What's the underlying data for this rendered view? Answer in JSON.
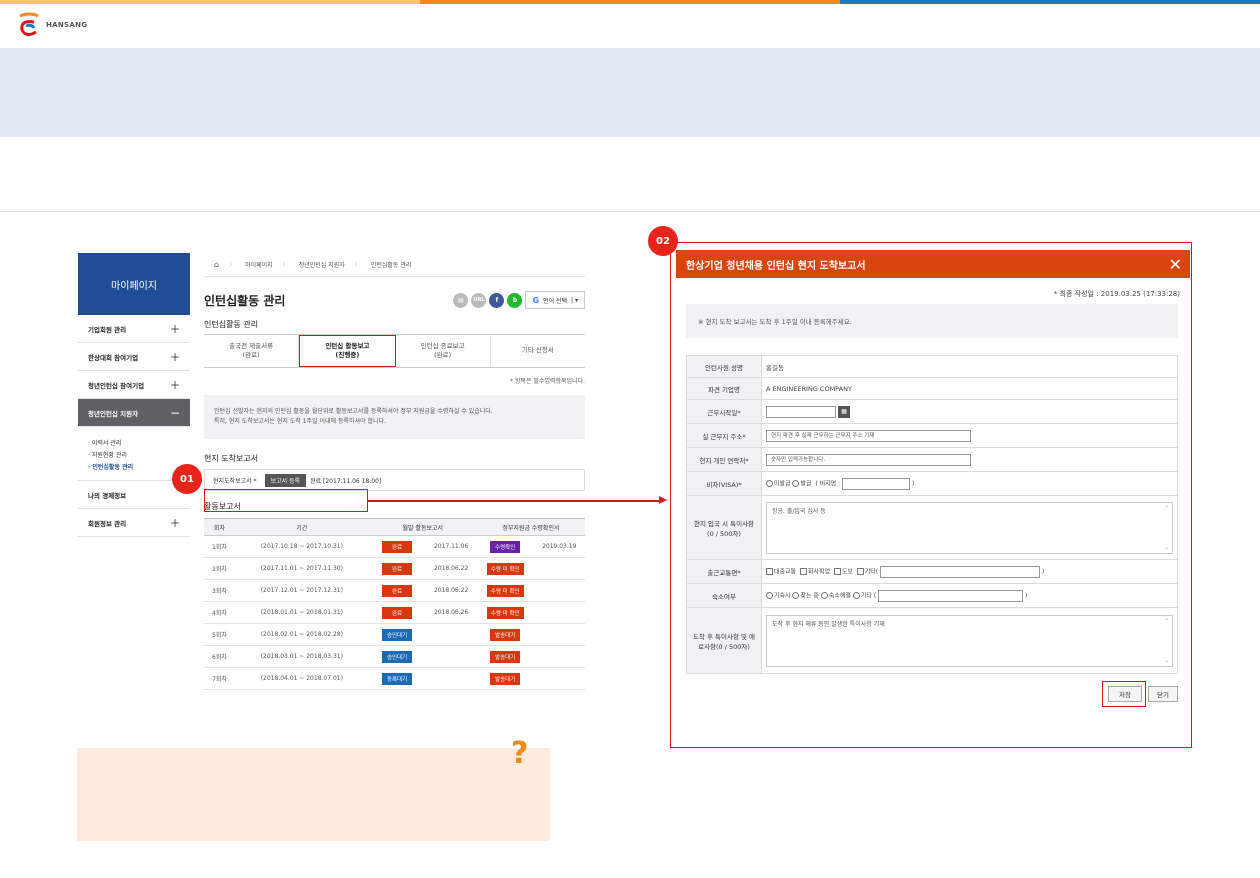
{
  "colors": {
    "top_bar": [
      "#f6c86a",
      "#f08a1c",
      "#1c7cc4"
    ],
    "brand_blue": "#1f4e96",
    "accent_red": "#d9141c",
    "modal_header": "#d9450e",
    "banner": "#e3e9f3",
    "help_box": "#fdebdf"
  },
  "logo": {
    "text": "HANSANG"
  },
  "sidebar": {
    "title": "마이페이지",
    "items": [
      {
        "label": "기업회원 관리",
        "toggle": "+"
      },
      {
        "label": "한상대회 참여기업",
        "toggle": "+"
      },
      {
        "label": "청년인턴십 참여기업",
        "toggle": "+"
      },
      {
        "label": "청년인턴십 지원자",
        "toggle": "−"
      },
      {
        "label": "나의 경제정보",
        "toggle": ""
      },
      {
        "label": "회원정보 관리",
        "toggle": "+"
      }
    ],
    "sub_items": [
      "이력서 관리",
      "지원현황 관리",
      "인턴십활동 관리"
    ]
  },
  "breadcrumb": [
    "마이페이지",
    "청년인턴십 지원자",
    "인턴십활동 관리"
  ],
  "page": {
    "title": "인턴십활동 관리",
    "section_title": "인턴십활동 관리",
    "lang_select": "언어 선택",
    "share_labels": [
      "URL",
      "f",
      "b"
    ],
    "tabs": [
      {
        "line1": "출국전 제출서류",
        "line2": "(완료)"
      },
      {
        "line1": "인턴십 활동보고",
        "line2": "(진행중)"
      },
      {
        "line1": "인턴십 종료보고",
        "line2": "(완료)"
      },
      {
        "line1": "기타 신청서",
        "line2": ""
      }
    ],
    "required_note": "* 항목은 필수입력항목입니다.",
    "notice_line1": "인턴십 선발자는 현지의 인턴십 활동을 월단위로 활동보고서를 등록하셔야 정부 지원금을 수령하실 수 있습니다.",
    "notice_line2": "특히, 현지 도착보고서는 현지 도착 1주일 이내에 등록하셔야 합니다.",
    "arrival_title": "현지 도착보고서",
    "arrival_label": "현지도착보고서 *",
    "arrival_button": "보고서 등록",
    "arrival_status": "완료 [2017.11.06 18:00]",
    "activity_title": "활동보고서",
    "table_headers": [
      "회차",
      "기간",
      "월말 활동보고서",
      "정부지원금 수령확인서"
    ],
    "rows": [
      {
        "no": "1회차",
        "period": "(2017.10.18 ~ 2017.10.31)",
        "report": "완료",
        "report_color": "red",
        "report_date": "2017.11.06",
        "gov": "수령확인",
        "gov_color": "purple",
        "gov_date": "2019.03.19"
      },
      {
        "no": "2회차",
        "period": "(2017.11.01 ~ 2017.11.30)",
        "report": "완료",
        "report_color": "red",
        "report_date": "2018.06.22",
        "gov": "수령 미 확인",
        "gov_color": "red",
        "gov_date": ""
      },
      {
        "no": "3회차",
        "period": "(2017.12.01 ~ 2017.12.31)",
        "report": "완료",
        "report_color": "red",
        "report_date": "2018.06.22",
        "gov": "수령 미 확인",
        "gov_color": "red",
        "gov_date": ""
      },
      {
        "no": "4회차",
        "period": "(2018.01.01 ~ 2018.01.31)",
        "report": "완료",
        "report_color": "red",
        "report_date": "2018.06.26",
        "gov": "수령 미 확인",
        "gov_color": "red",
        "gov_date": ""
      },
      {
        "no": "5회차",
        "period": "(2018.02.01 ~ 2018.02.28)",
        "report": "승인대기",
        "report_color": "blue",
        "report_date": "",
        "gov": "발송대기",
        "gov_color": "red",
        "gov_date": ""
      },
      {
        "no": "6회차",
        "period": "(2018.03.01 ~ 2018.03.31)",
        "report": "승인대기",
        "report_color": "blue",
        "report_date": "",
        "gov": "발송대기",
        "gov_color": "red",
        "gov_date": ""
      },
      {
        "no": "7회차",
        "period": "(2018.04.01 ~ 2018.07.01)",
        "report": "등록대기",
        "report_color": "blue",
        "report_date": "",
        "gov": "발송대기",
        "gov_color": "red",
        "gov_date": ""
      }
    ]
  },
  "callouts": [
    "01",
    "02"
  ],
  "help_mark": "?",
  "modal": {
    "title": "한상기업 청년채용 인턴십 현지 도착보고서",
    "close": "✕",
    "last_saved": "* 최종 작성일 : 2019.03.25 (17:33:28)",
    "notice": "※ 현지 도착 보고서는 도착 후 1주일 이내 등록해주세요.",
    "fields": {
      "name_label": "인턴사원 성명",
      "name_value": "홍길동",
      "company_label": "파견 기업명",
      "company_value": "A ENGINEERING COMPANY",
      "start_label": "근무시작일*",
      "address_label": "실 근무지 주소*",
      "address_placeholder": "현지 파견 후 실제 근무하는 근무지 주소 기재",
      "contact_label": "현지 개인 연락처*",
      "contact_placeholder": "숫자만 입력가능합니다.",
      "visa_label": "비자(VISA)*",
      "visa_options": [
        "미발급",
        "발급"
      ],
      "visa_name_label": "( 비자명 :",
      "visa_close": ")",
      "entry_label": "현지 입국 시 특이사항 (0 / 500자)",
      "entry_placeholder": "항공, 출/입국 심사 등",
      "commute_label": "출근교통편*",
      "commute_options": [
        "대중교통",
        "회사픽업",
        "도보",
        "기타("
      ],
      "commute_close": ")",
      "lodging_label": "숙소여부",
      "lodging_options": [
        "기숙사",
        "찾는 중",
        "숙소해결",
        "기타"
      ],
      "lodging_open": "(",
      "lodging_close": ")",
      "issue_label": "도착 후 특이사항 및 애로사항(0 / 500자)",
      "issue_placeholder": "도착 후 현지 체류 동안 발생한 특이사항 기재"
    },
    "save_button": "저장",
    "close_button": "닫기"
  }
}
